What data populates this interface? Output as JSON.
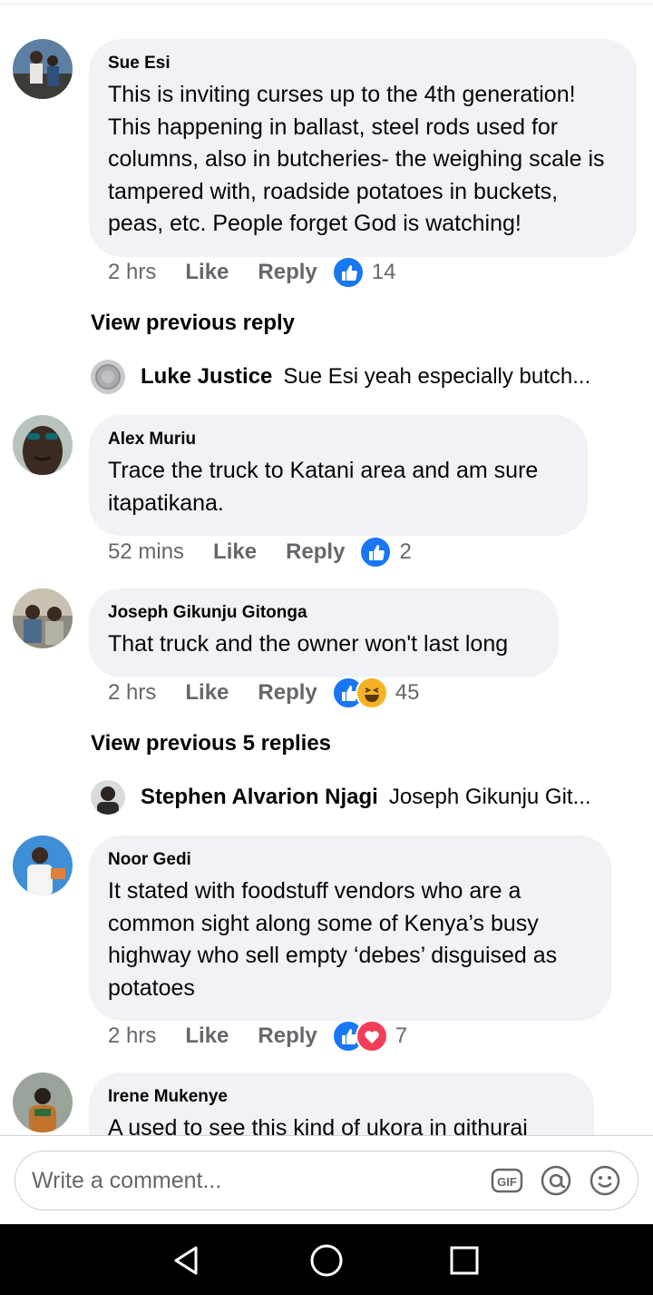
{
  "comments": [
    {
      "author": "Sue Esi",
      "text": "This is inviting curses up to the 4th generation! This happening in ballast, steel rods used for columns, also in butcheries- the weighing scale is tampered with, roadside potatoes in buckets, peas, etc. People forget God is watching!",
      "time": "2 hrs",
      "like_label": "Like",
      "reply_label": "Reply",
      "reaction_count": "14",
      "view_previous": "View previous reply",
      "reply_preview": {
        "name": "Luke Justice",
        "text": "Sue Esi yeah especially butch..."
      }
    },
    {
      "author": "Alex Muriu",
      "text": "Trace the truck to Katani area and am sure itapatikana.",
      "time": "52 mins",
      "like_label": "Like",
      "reply_label": "Reply",
      "reaction_count": "2"
    },
    {
      "author": "Joseph Gikunju Gitonga",
      "text": "That truck and the owner won't last long",
      "time": "2 hrs",
      "like_label": "Like",
      "reply_label": "Reply",
      "reaction_count": "45",
      "view_previous": "View previous 5 replies",
      "reply_preview": {
        "name": "Stephen Alvarion Njagi",
        "text": "Joseph Gikunju Git..."
      }
    },
    {
      "author": "Noor Gedi",
      "text": "It stated with  foodstuff vendors who are a common sight along some of Kenya’s busy highway who sell empty ‘debes’ disguised as potatoes",
      "time": "2 hrs",
      "like_label": "Like",
      "reply_label": "Reply",
      "reaction_count": "7"
    },
    {
      "author": "Irene Mukenye",
      "text": "A used to see this kind of ukora in githurai"
    }
  ],
  "composer": {
    "placeholder": "Write a comment..."
  },
  "icons": [
    "gif-icon",
    "at-mention-icon",
    "emoji-icon",
    "back-nav-icon",
    "home-nav-icon",
    "recents-nav-icon"
  ],
  "colors": {
    "like_blue": "#1877f2",
    "bubble": "#f0f2f5",
    "meta_gray": "#65676b"
  }
}
